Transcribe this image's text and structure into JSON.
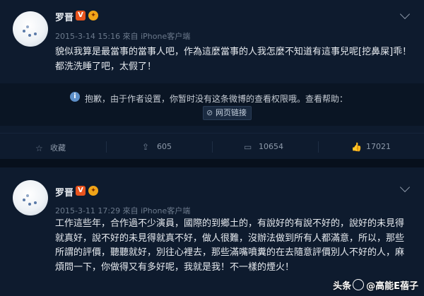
{
  "post1": {
    "author": "罗晋",
    "v_badge": "V",
    "level_badge": "✦",
    "meta": "2015-3-14 15:16 來自 iPhone客户端",
    "text": "貌似我算是最當事的當事人吧，作為這麼當事的人我怎麼不知道有這事兒呢[挖鼻屎]乖！都洗洗睡了吧，太假了！",
    "notice": {
      "text": "抱歉，由于作者设置，你暂时没有这条微博的查看权限哦。查看帮助：",
      "link_label": "网页链接"
    },
    "actions": {
      "favorite": "收藏",
      "repost": "605",
      "comment": "10654",
      "like": "17021"
    }
  },
  "post2": {
    "author": "罗晋",
    "v_badge": "V",
    "level_badge": "✦",
    "meta": "2015-3-11 17:29 來自 iPhone客户端",
    "text": "工作這些年，合作過不少演員，國際的到鄉土的，有說好的有說不好的，說好的未見得就真好，說不好的未見得就真不好，做人很難，沒辦法做到所有人都滿意，所以，那些所謂的評價，聽聽就好，別往心裡去，那些滿嘴噴糞的在去隨意評價別人不好的人，麻煩問一下，你做得又有多好呢，我就是我！不一樣的煙火！"
  },
  "watermark": {
    "prefix": "头条",
    "handle": "@高能E蓓子"
  }
}
